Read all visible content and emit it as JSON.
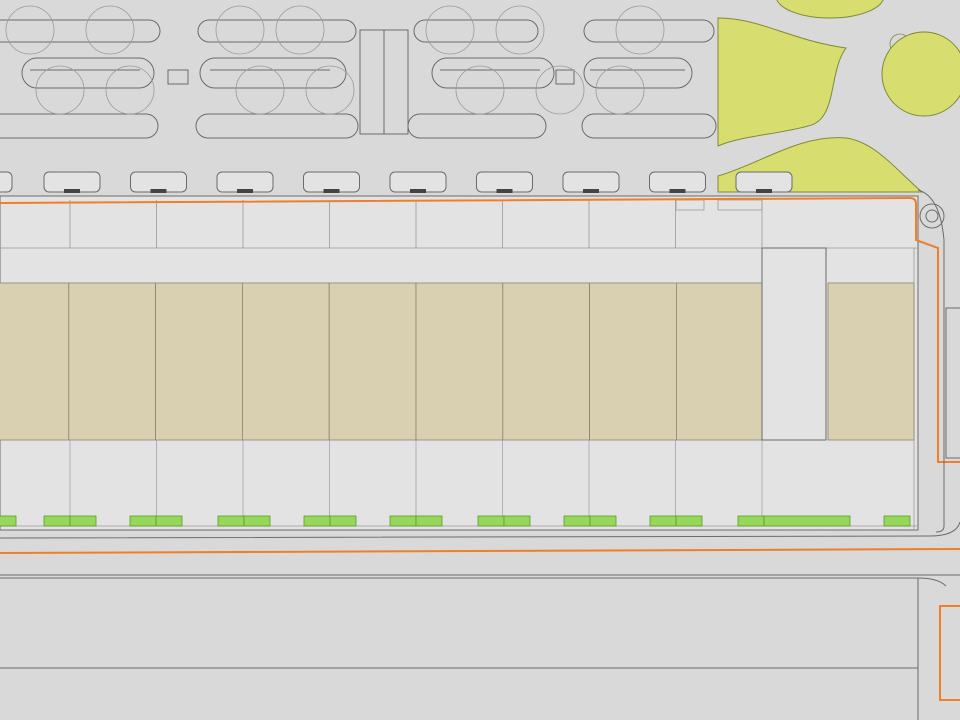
{
  "plan": {
    "colors": {
      "ground": "#d9d9d9",
      "paving": "#e3e3e3",
      "road_line": "#6b6b6b",
      "building": "#d9d0b1",
      "building_edge": "#8a8372",
      "lawn": "#d7dd6e",
      "lawn_edge": "#7f8a3a",
      "planter": "#97d85a",
      "property_line": "#ef7f2a",
      "tree_outline": "#9a9a9a"
    },
    "unit_count": 10,
    "parking_bay_count": 9,
    "planter_count": 19
  }
}
